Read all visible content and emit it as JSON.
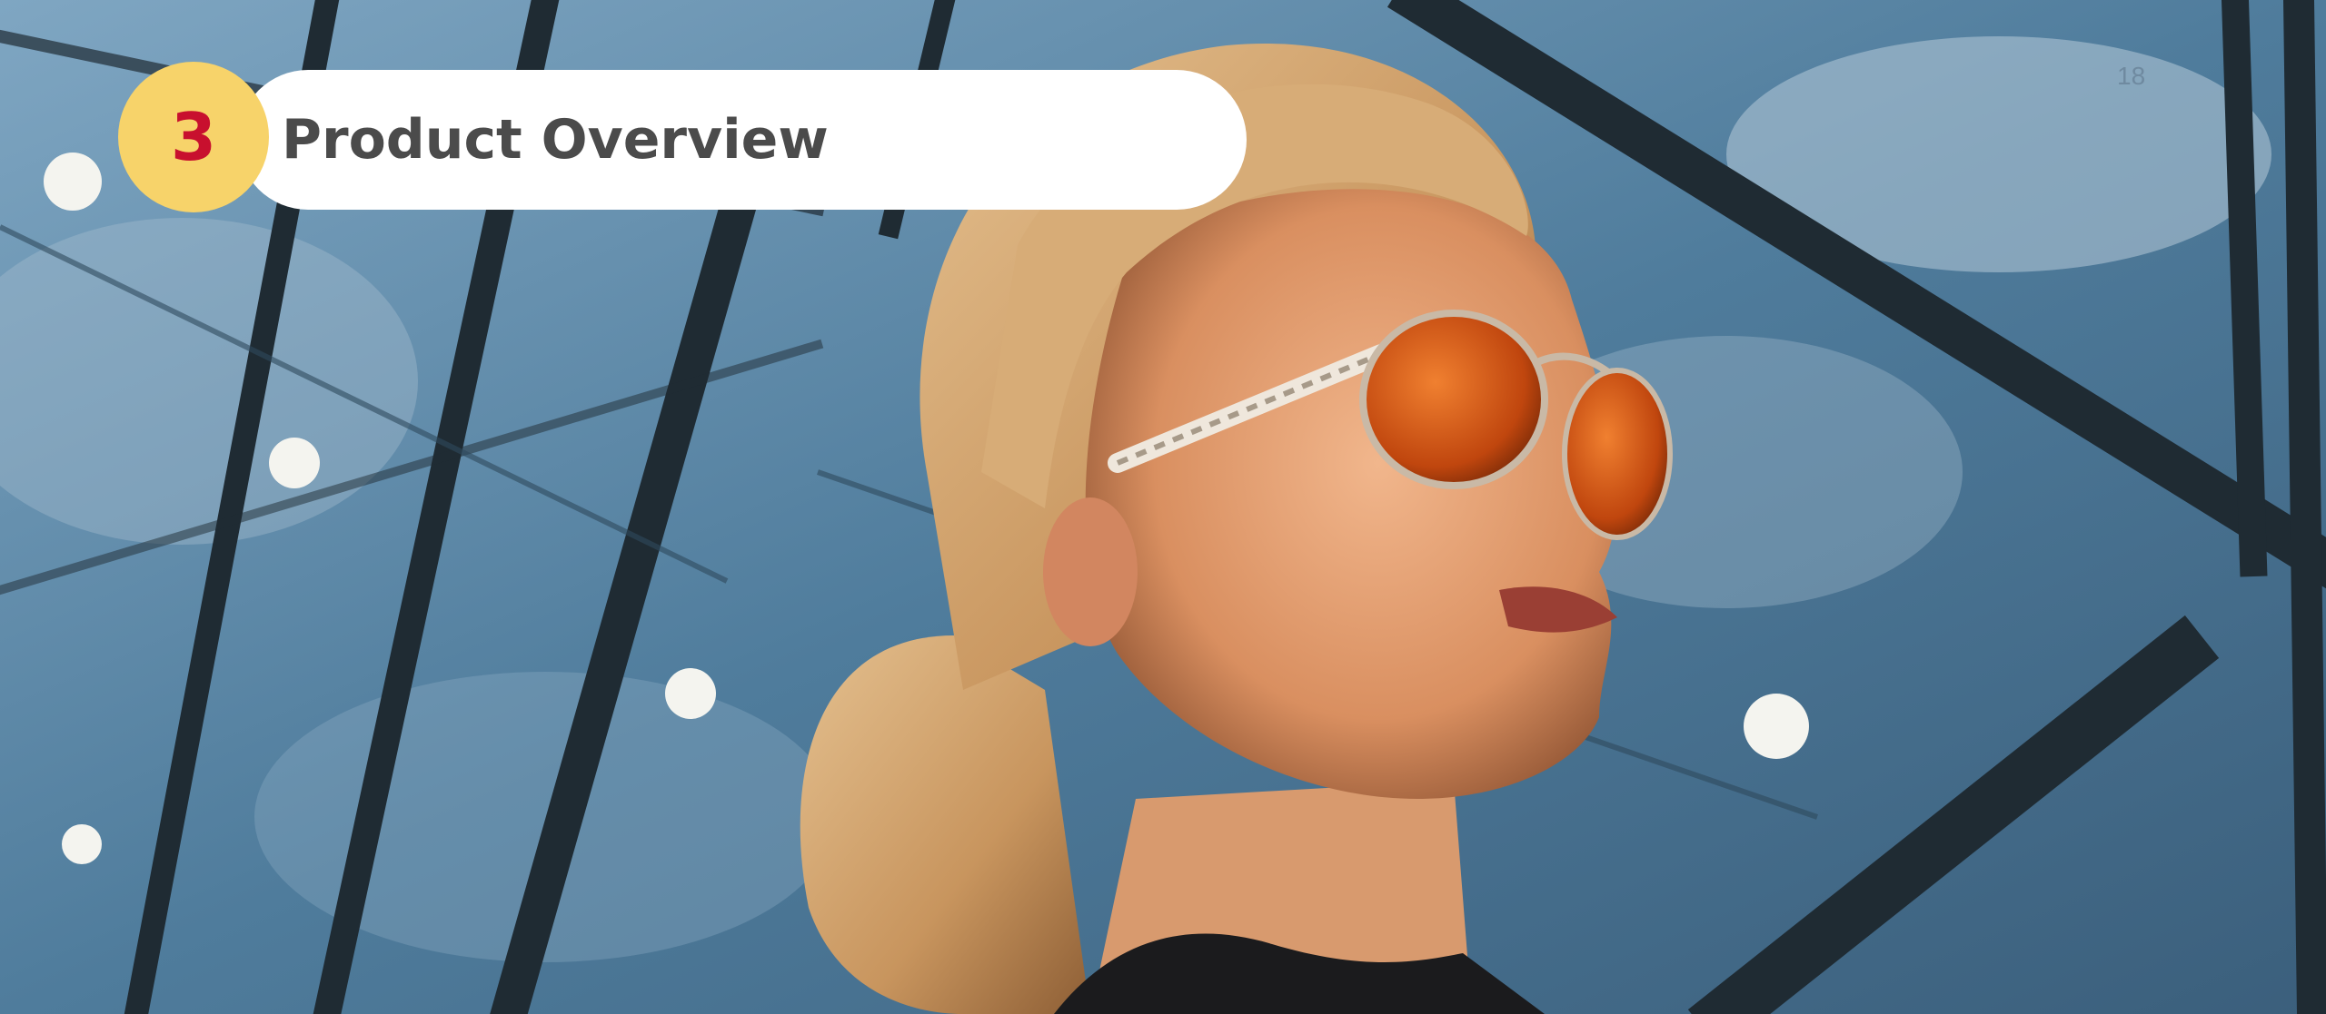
{
  "slide": {
    "section_number": "3",
    "title": "Product Overview",
    "page_number": "18"
  },
  "colors": {
    "accent_yellow": "#f7d36a",
    "number_red": "#c8102e",
    "title_gray": "#4b4b4b"
  },
  "icons": [
    "photo-woman-sunglasses"
  ]
}
